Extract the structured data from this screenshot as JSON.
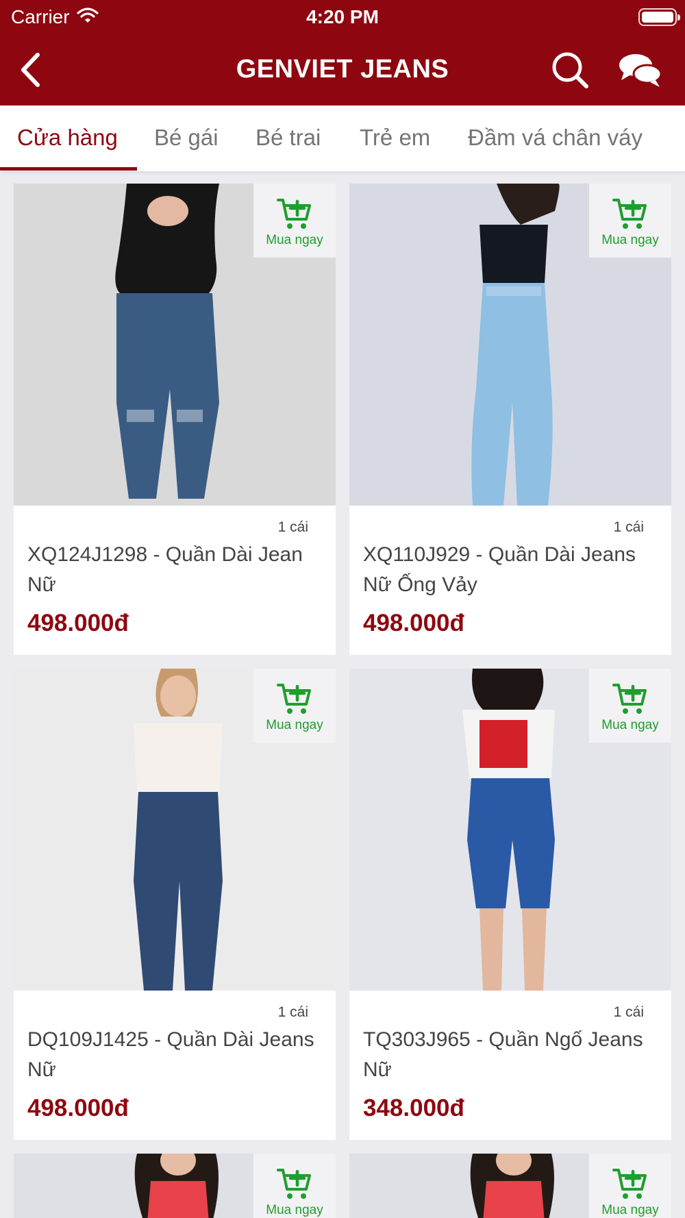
{
  "status_bar": {
    "carrier": "Carrier",
    "time": "4:20 PM"
  },
  "nav": {
    "title": "GENVIET JEANS"
  },
  "tabs": [
    "Cửa hàng",
    "Bé gái",
    "Bé trai",
    "Trẻ em",
    "Đầm vá chân váy"
  ],
  "active_tab": "Cửa hàng",
  "products": [
    {
      "qty": "1 cái",
      "name": "XQ124J1298 - Quần Dài Jean Nữ",
      "price": "498.000đ",
      "buy_label": "Mua ngay"
    },
    {
      "qty": "1 cái",
      "name": "XQ110J929 - Quần Dài Jeans Nữ Ống Vảy",
      "price": "498.000đ",
      "buy_label": "Mua ngay"
    },
    {
      "qty": "1 cái",
      "name": "DQ109J1425 - Quần Dài Jeans Nữ",
      "price": "498.000đ",
      "buy_label": "Mua ngay"
    },
    {
      "qty": "1 cái",
      "name": "TQ303J965 - Quần Ngố Jeans Nữ",
      "price": "348.000đ",
      "buy_label": "Mua ngay"
    }
  ],
  "partial_cards": [
    {
      "buy_label": "Mua ngay"
    },
    {
      "buy_label": "Mua ngay"
    }
  ],
  "colors": {
    "brand": "#8e0710",
    "buy_green": "#1f9e2c",
    "background": "#ebebf0"
  },
  "icons": [
    "wifi-icon",
    "battery-icon",
    "back-chevron-icon",
    "search-icon",
    "chat-bubbles-icon",
    "cart-plus-icon"
  ]
}
